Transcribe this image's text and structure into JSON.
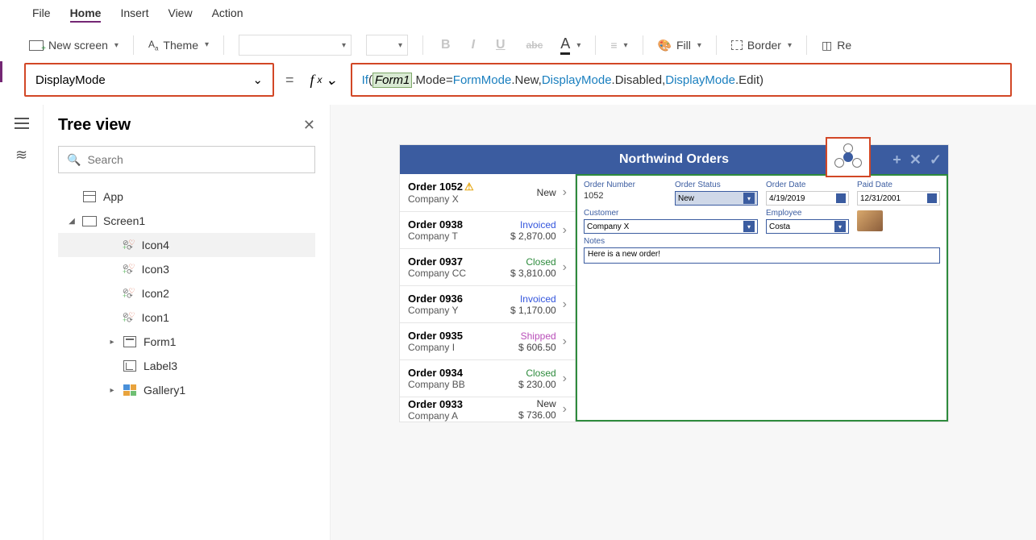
{
  "menu": {
    "file": "File",
    "home": "Home",
    "insert": "Insert",
    "view": "View",
    "action": "Action"
  },
  "toolbar": {
    "newscreen": "New screen",
    "theme": "Theme",
    "fill": "Fill",
    "border": "Border",
    "re": "Re"
  },
  "formula": {
    "property": "DisplayMode",
    "expr": {
      "if": "If",
      "form": "Form1",
      "mode": ".Mode",
      "eq": " = ",
      "fmode": "FormMode",
      "new": ".New, ",
      "dmode": "DisplayMode",
      "dis": ".Disabled, ",
      "dmode2": "DisplayMode",
      "edit": ".Edit"
    }
  },
  "tree": {
    "title": "Tree view",
    "search_ph": "Search",
    "app": "App",
    "screen": "Screen1",
    "icons": [
      "Icon4",
      "Icon3",
      "Icon2",
      "Icon1"
    ],
    "form": "Form1",
    "label": "Label3",
    "gallery": "Gallery1"
  },
  "preview": {
    "title": "Northwind Orders",
    "orders": [
      {
        "t": "Order 1052",
        "c": "Company X",
        "s": "New",
        "sc": "s-new",
        "amt": "",
        "warn": true
      },
      {
        "t": "Order 0938",
        "c": "Company T",
        "s": "Invoiced",
        "sc": "s-invoiced",
        "amt": "$ 2,870.00"
      },
      {
        "t": "Order 0937",
        "c": "Company CC",
        "s": "Closed",
        "sc": "s-closed",
        "amt": "$ 3,810.00"
      },
      {
        "t": "Order 0936",
        "c": "Company Y",
        "s": "Invoiced",
        "sc": "s-invoiced",
        "amt": "$ 1,170.00"
      },
      {
        "t": "Order 0935",
        "c": "Company I",
        "s": "Shipped",
        "sc": "s-shipped",
        "amt": "$ 606.50"
      },
      {
        "t": "Order 0934",
        "c": "Company BB",
        "s": "Closed",
        "sc": "s-closed",
        "amt": "$ 230.00"
      },
      {
        "t": "Order 0933",
        "c": "Company A",
        "s": "New",
        "sc": "s-new",
        "amt": "$ 736.00"
      }
    ],
    "detail": {
      "ordnum_l": "Order Number",
      "ordnum": "1052",
      "status_l": "Order Status",
      "status": "New",
      "odate_l": "Order Date",
      "odate": "4/19/2019",
      "pdate_l": "Paid Date",
      "pdate": "12/31/2001",
      "cust_l": "Customer",
      "cust": "Company X",
      "emp_l": "Employee",
      "emp": "Costa",
      "notes_l": "Notes",
      "notes": "Here is a new order!"
    }
  }
}
